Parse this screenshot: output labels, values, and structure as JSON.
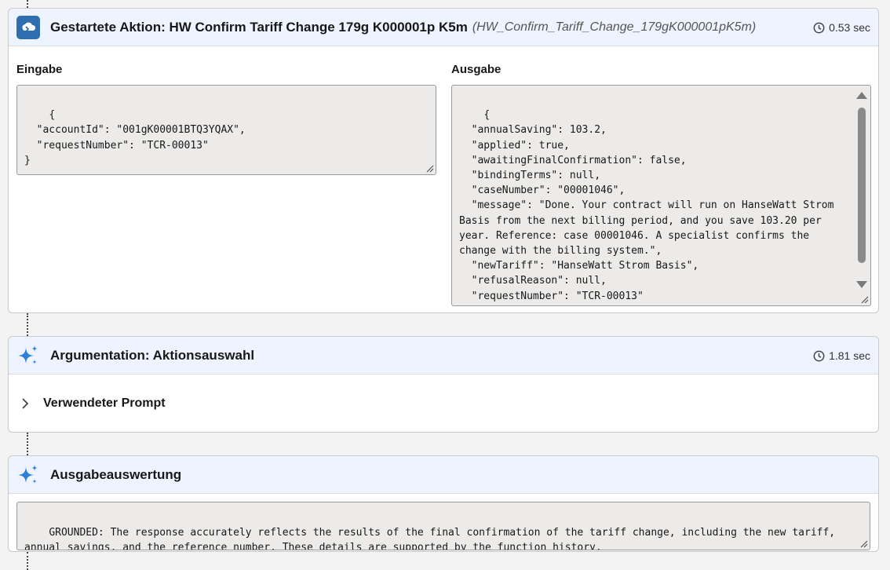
{
  "action_card": {
    "title": "Gestartete Aktion: HW Confirm Tariff Change 179g K000001p K5m",
    "api_name": "(HW_Confirm_Tariff_Change_179gK000001pK5m)",
    "duration": "0.53 sec",
    "input_label": "Eingabe",
    "output_label": "Ausgabe",
    "input_json": "{\n  \"accountId\": \"001gK00001BTQ3YQAX\",\n  \"requestNumber\": \"TCR-00013\"\n}",
    "output_json": "{\n  \"annualSaving\": 103.2,\n  \"applied\": true,\n  \"awaitingFinalConfirmation\": false,\n  \"bindingTerms\": null,\n  \"caseNumber\": \"00001046\",\n  \"message\": \"Done. Your contract will run on HanseWatt Strom Basis from the next billing period, and you save 103.20 per year. Reference: case 00001046. A specialist confirms the change with the billing system.\",\n  \"newTariff\": \"HanseWatt Strom Basis\",\n  \"refusalReason\": null,\n  \"requestNumber\": \"TCR-00013\"\n}"
  },
  "reasoning_card": {
    "title": "Argumentation: Aktionsauswahl",
    "duration": "1.81 sec",
    "prompt_label": "Verwendeter Prompt"
  },
  "evaluation_card": {
    "title": "Ausgabeauswertung",
    "text": "GROUNDED: The response accurately reflects the results of the final confirmation of the tariff change, including the new tariff, annual savings, and the reference number. These details are supported by the function history."
  },
  "icons": {
    "action": "cloud-flow-icon",
    "reasoning": "sparkle-icon",
    "evaluation": "sparkle-icon",
    "duration": "clock-icon",
    "expand": "chevron-right-icon"
  },
  "colors": {
    "header_bg": "#eef4ff",
    "action_icon_bg": "#2f6fb0",
    "sparkle": "#2e7fd6"
  }
}
